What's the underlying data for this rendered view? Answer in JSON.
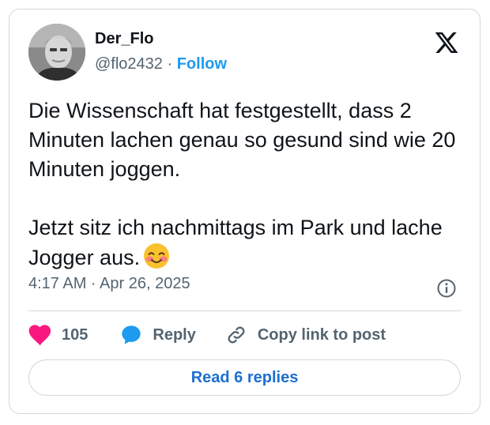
{
  "author": {
    "display_name": "Der_Flo",
    "handle": "@flo2432",
    "separator": "·",
    "follow_label": "Follow"
  },
  "post": {
    "text": "Die Wissenschaft hat festgestellt, dass 2 Minuten lachen genau so gesund sind wie 20 Minuten joggen.\n\nJetzt sitz ich nachmittags im Park und lache Jogger aus.",
    "emoji": "smiling-face-with-blush-emoji",
    "timestamp": "4:17 AM · Apr 26, 2025"
  },
  "actions": {
    "like_count": "105",
    "reply_label": "Reply",
    "copy_link_label": "Copy link to post"
  },
  "read_replies_label": "Read 6 replies",
  "colors": {
    "link_blue": "#1d9bf0",
    "like_pink": "#f91880",
    "muted_gray": "#536471",
    "border": "#cfd9de"
  },
  "icons": [
    "x-logo-icon",
    "info-icon",
    "heart-icon",
    "reply-bubble-icon",
    "link-icon"
  ]
}
